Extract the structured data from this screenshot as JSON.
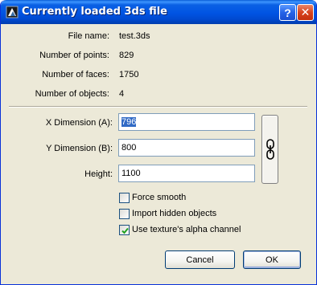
{
  "window": {
    "title": "Currently loaded 3ds file",
    "help_label": "?",
    "close_label": "✕"
  },
  "info": {
    "rows": [
      {
        "label": "File name:",
        "value": "test.3ds"
      },
      {
        "label": "Number of points:",
        "value": "829"
      },
      {
        "label": "Number of faces:",
        "value": "1750"
      },
      {
        "label": "Number of objects:",
        "value": "4"
      }
    ]
  },
  "dimensions": {
    "x_label": "X Dimension (A):",
    "x_value": "796",
    "y_label": "Y Dimension (B):",
    "y_value": "800",
    "height_label": "Height:",
    "height_value": "1100",
    "link_icon": "chain-link-icon"
  },
  "options": {
    "force_smooth": {
      "label": "Force smooth",
      "checked": false
    },
    "import_hidden": {
      "label": "Import hidden objects",
      "checked": false
    },
    "use_alpha": {
      "label": "Use texture's alpha channel",
      "checked": true
    }
  },
  "buttons": {
    "cancel": "Cancel",
    "ok": "OK"
  },
  "colors": {
    "titlebar": "#0054e3",
    "dialog_bg": "#ece9d8",
    "selection": "#316ac5",
    "close": "#d7431e"
  }
}
